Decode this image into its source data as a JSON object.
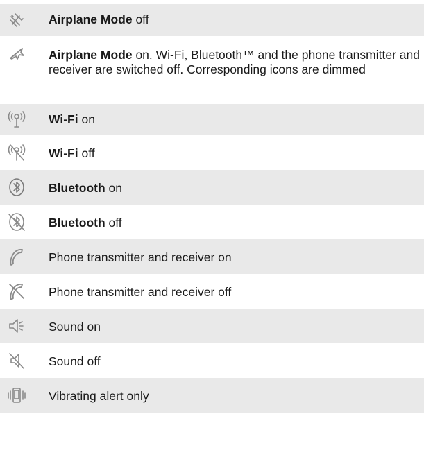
{
  "rows": [
    {
      "id": "airplane-off",
      "icon": "airplane-mode-off-icon",
      "shaded": true,
      "bold": "Airplane Mode",
      "rest": " off"
    },
    {
      "id": "airplane-on",
      "icon": "airplane-mode-on-icon",
      "shaded": false,
      "bold": "Airplane Mode",
      "rest": " on. Wi-Fi, Bluetooth™ and the phone transmitter and receiver are switched off. Corresponding icons are dimmed"
    },
    {
      "id": "wifi-on",
      "icon": "wifi-on-icon",
      "shaded": true,
      "bold": "Wi-Fi",
      "rest": " on"
    },
    {
      "id": "wifi-off",
      "icon": "wifi-off-icon",
      "shaded": false,
      "bold": "Wi-Fi",
      "rest": " off"
    },
    {
      "id": "bluetooth-on",
      "icon": "bluetooth-on-icon",
      "shaded": true,
      "bold": "Bluetooth",
      "rest": " on"
    },
    {
      "id": "bluetooth-off",
      "icon": "bluetooth-off-icon",
      "shaded": false,
      "bold": "Bluetooth",
      "rest": " off"
    },
    {
      "id": "phone-on",
      "icon": "phone-on-icon",
      "shaded": true,
      "bold": "",
      "rest": "Phone transmitter and receiver on"
    },
    {
      "id": "phone-off",
      "icon": "phone-off-icon",
      "shaded": false,
      "bold": "",
      "rest": "Phone transmitter and receiver off"
    },
    {
      "id": "sound-on",
      "icon": "sound-on-icon",
      "shaded": true,
      "bold": "",
      "rest": "Sound on"
    },
    {
      "id": "sound-off",
      "icon": "sound-off-icon",
      "shaded": false,
      "bold": "",
      "rest": "Sound off"
    },
    {
      "id": "vibrate",
      "icon": "vibrating-alert-icon",
      "shaded": true,
      "bold": "",
      "rest": "Vibrating alert only"
    }
  ],
  "colors": {
    "shade": "#e9e9e9",
    "icon": "#8a8a8a",
    "text": "#1a1a1a"
  }
}
